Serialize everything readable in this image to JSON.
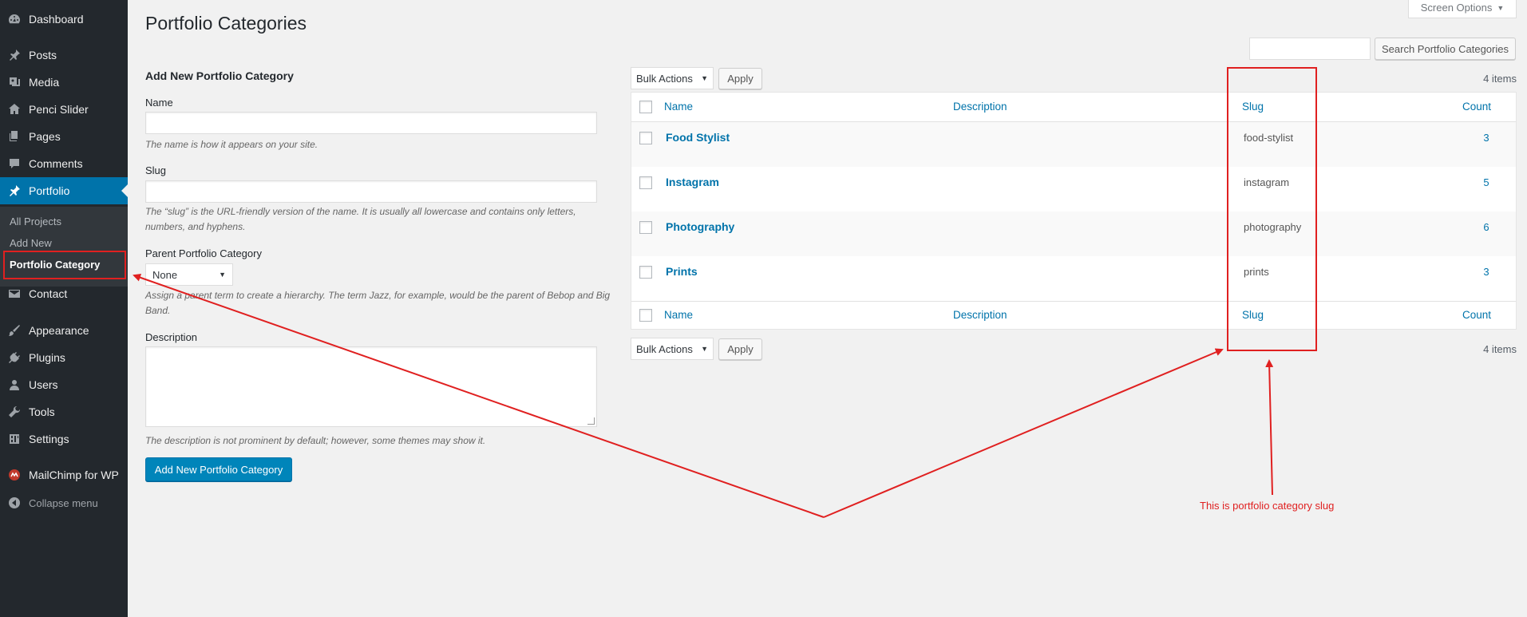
{
  "sidebar": {
    "items": [
      {
        "label": "Dashboard",
        "icon": "dashboard-icon"
      },
      {
        "label": "Posts",
        "icon": "pin-icon"
      },
      {
        "label": "Media",
        "icon": "media-icon"
      },
      {
        "label": "Penci Slider",
        "icon": "home-icon"
      },
      {
        "label": "Pages",
        "icon": "pages-icon"
      },
      {
        "label": "Comments",
        "icon": "comment-icon"
      },
      {
        "label": "Portfolio",
        "icon": "pin-icon"
      },
      {
        "label": "Contact",
        "icon": "mail-icon"
      },
      {
        "label": "Appearance",
        "icon": "brush-icon"
      },
      {
        "label": "Plugins",
        "icon": "plug-icon"
      },
      {
        "label": "Users",
        "icon": "user-icon"
      },
      {
        "label": "Tools",
        "icon": "wrench-icon"
      },
      {
        "label": "Settings",
        "icon": "settings-icon"
      },
      {
        "label": "MailChimp for WP",
        "icon": "mailchimp-icon"
      }
    ],
    "submenu": [
      "All Projects",
      "Add New",
      "Portfolio Category"
    ],
    "collapse_label": "Collapse menu"
  },
  "page": {
    "title": "Portfolio Categories",
    "screen_options": "Screen Options",
    "search_button": "Search Portfolio Categories"
  },
  "form": {
    "heading": "Add New Portfolio Category",
    "name_label": "Name",
    "name_help": "The name is how it appears on your site.",
    "slug_label": "Slug",
    "slug_help": "The “slug” is the URL-friendly version of the name. It is usually all lowercase and contains only letters, numbers, and hyphens.",
    "parent_label": "Parent Portfolio Category",
    "parent_value": "None",
    "parent_help": "Assign a parent term to create a hierarchy. The term Jazz, for example, would be the parent of Bebop and Big Band.",
    "description_label": "Description",
    "description_help": "The description is not prominent by default; however, some themes may show it.",
    "submit_label": "Add New Portfolio Category"
  },
  "table": {
    "bulk_actions": "Bulk Actions",
    "apply": "Apply",
    "items_count": "4 items",
    "columns": [
      "Name",
      "Description",
      "Slug",
      "Count"
    ],
    "rows": [
      {
        "name": "Food Stylist",
        "slug": "food-stylist",
        "count": "3"
      },
      {
        "name": "Instagram",
        "slug": "instagram",
        "count": "5"
      },
      {
        "name": "Photography",
        "slug": "photography",
        "count": "6"
      },
      {
        "name": "Prints",
        "slug": "prints",
        "count": "3"
      }
    ]
  },
  "annotation": {
    "text": "This is portfolio category slug",
    "color": "#e02020"
  },
  "colors": {
    "sidebar_bg": "#23282d",
    "active_bg": "#0073aa",
    "link": "#0073aa",
    "primary_button": "#0085ba"
  }
}
